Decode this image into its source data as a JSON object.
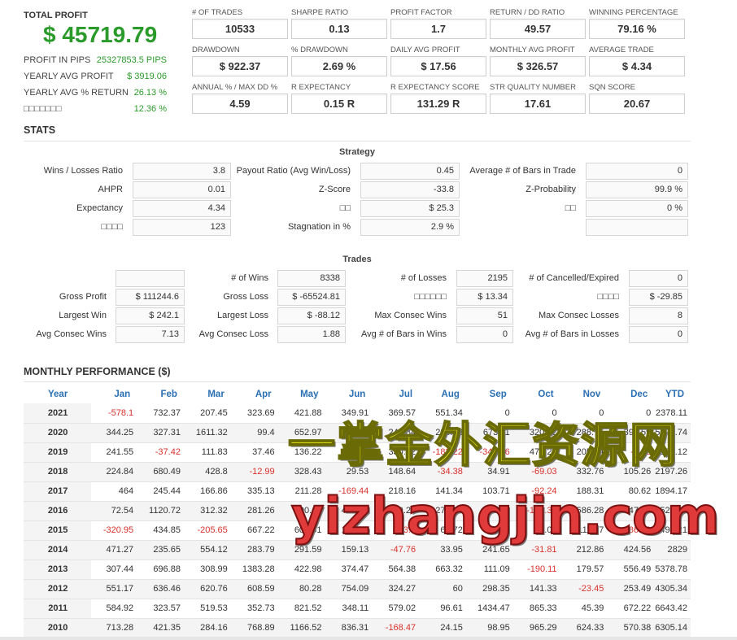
{
  "summary": {
    "total_profit_label": "TOTAL PROFIT",
    "total_profit_value": "$ 45719.79",
    "rows": [
      {
        "label": "PROFIT IN PIPS",
        "value": "25327853.5 PIPS"
      },
      {
        "label": "YEARLY AVG PROFIT",
        "value": "$ 3919.06"
      },
      {
        "label": "YEARLY AVG % RETURN",
        "value": "26.13 %"
      },
      {
        "label": "□□□□□□□",
        "value": "12.36 %"
      }
    ]
  },
  "metrics": [
    {
      "label": "# OF TRADES",
      "value": "10533"
    },
    {
      "label": "SHARPE RATIO",
      "value": "0.13"
    },
    {
      "label": "PROFIT FACTOR",
      "value": "1.7"
    },
    {
      "label": "RETURN / DD RATIO",
      "value": "49.57"
    },
    {
      "label": "WINNING PERCENTAGE",
      "value": "79.16 %"
    },
    {
      "label": "DRAWDOWN",
      "value": "$ 922.37"
    },
    {
      "label": "% DRAWDOWN",
      "value": "2.69 %"
    },
    {
      "label": "DAILY AVG PROFIT",
      "value": "$ 17.56"
    },
    {
      "label": "MONTHLY AVG PROFIT",
      "value": "$ 326.57"
    },
    {
      "label": "AVERAGE TRADE",
      "value": "$ 4.34"
    },
    {
      "label": "ANNUAL % / MAX DD %",
      "value": "4.59"
    },
    {
      "label": "R EXPECTANCY",
      "value": "0.15 R"
    },
    {
      "label": "R EXPECTANCY SCORE",
      "value": "131.29 R"
    },
    {
      "label": "STR QUALITY NUMBER",
      "value": "17.61"
    },
    {
      "label": "SQN SCORE",
      "value": "20.67"
    }
  ],
  "stats_title": "STATS",
  "strategy": {
    "title": "Strategy",
    "rows": [
      [
        {
          "label": "Wins / Losses Ratio",
          "value": "3.8"
        },
        {
          "label": "Payout Ratio (Avg Win/Loss)",
          "value": "0.45"
        },
        {
          "label": "Average # of Bars in Trade",
          "value": "0"
        }
      ],
      [
        {
          "label": "AHPR",
          "value": "0.01"
        },
        {
          "label": "Z-Score",
          "value": "-33.8"
        },
        {
          "label": "Z-Probability",
          "value": "99.9 %"
        }
      ],
      [
        {
          "label": "Expectancy",
          "value": "4.34"
        },
        {
          "label": "□□",
          "value": "$ 25.3"
        },
        {
          "label": "□□",
          "value": "0 %"
        }
      ],
      [
        {
          "label": "□□□□",
          "value": "123"
        },
        {
          "label": "Stagnation in %",
          "value": "2.9 %"
        },
        {
          "label": "",
          "value": ""
        }
      ]
    ]
  },
  "trades": {
    "title": "Trades",
    "rows": [
      [
        {
          "label": "",
          "value": ""
        },
        {
          "label": "# of Wins",
          "value": "8338"
        },
        {
          "label": "# of Losses",
          "value": "2195"
        },
        {
          "label": "# of Cancelled/Expired",
          "value": "0"
        }
      ],
      [
        {
          "label": "Gross Profit",
          "value": "$ 111244.6"
        },
        {
          "label": "Gross Loss",
          "value": "$ -65524.81"
        },
        {
          "label": "□□□□□□",
          "value": "$ 13.34"
        },
        {
          "label": "□□□□",
          "value": "$ -29.85"
        }
      ],
      [
        {
          "label": "Largest Win",
          "value": "$ 242.1"
        },
        {
          "label": "Largest Loss",
          "value": "$ -88.12"
        },
        {
          "label": "Max Consec Wins",
          "value": "51"
        },
        {
          "label": "Max Consec Losses",
          "value": "8"
        }
      ],
      [
        {
          "label": "Avg Consec Wins",
          "value": "7.13"
        },
        {
          "label": "Avg Consec Loss",
          "value": "1.88"
        },
        {
          "label": "Avg # of Bars in Wins",
          "value": "0"
        },
        {
          "label": "Avg # of Bars in Losses",
          "value": "0"
        }
      ]
    ]
  },
  "monthly": {
    "title": "MONTHLY PERFORMANCE ($)",
    "headers": [
      "Year",
      "Jan",
      "Feb",
      "Mar",
      "Apr",
      "May",
      "Jun",
      "Jul",
      "Aug",
      "Sep",
      "Oct",
      "Nov",
      "Dec",
      "YTD"
    ],
    "rows": [
      [
        "2021",
        "-578.1",
        "732.37",
        "207.45",
        "323.69",
        "421.88",
        "349.91",
        "369.57",
        "551.34",
        "0",
        "0",
        "0",
        "0",
        "2378.11"
      ],
      [
        "2020",
        "344.25",
        "327.31",
        "1611.32",
        "99.4",
        "652.97",
        "935.58",
        "244.84",
        "285.76",
        "673.11",
        "320.92",
        "288.75",
        "395.59",
        "5878.74"
      ],
      [
        "2019",
        "241.55",
        "-37.42",
        "111.83",
        "37.46",
        "136.22",
        "-4.85",
        "330.52",
        "-182.22",
        "-347.36",
        "478.27",
        "205.44",
        "-2.02",
        "1127.12"
      ],
      [
        "2018",
        "224.84",
        "680.49",
        "428.8",
        "-12.99",
        "328.43",
        "29.53",
        "148.64",
        "-34.38",
        "34.91",
        "-69.03",
        "332.76",
        "105.26",
        "2197.26"
      ],
      [
        "2017",
        "464",
        "245.44",
        "166.86",
        "335.13",
        "211.28",
        "-169.44",
        "218.16",
        "141.34",
        "103.71",
        "-92.24",
        "188.31",
        "80.62",
        "1894.17"
      ],
      [
        "2016",
        "72.54",
        "1120.72",
        "312.32",
        "281.26",
        "400.68",
        "482.78",
        "879.28",
        "270.98",
        "484.45",
        "-152.37",
        "586.28",
        "547.59",
        "5286.5"
      ],
      [
        "2015",
        "-320.95",
        "434.85",
        "-205.65",
        "667.22",
        "602.61",
        "176.78",
        "-93.9",
        "68.72",
        "156",
        "90.05",
        "111.97",
        "-186.49",
        "1495.21"
      ],
      [
        "2014",
        "471.27",
        "235.65",
        "554.12",
        "283.79",
        "291.59",
        "159.13",
        "-47.76",
        "33.95",
        "241.65",
        "-31.81",
        "212.86",
        "424.56",
        "2829"
      ],
      [
        "2013",
        "307.44",
        "696.88",
        "308.99",
        "1383.28",
        "422.98",
        "374.47",
        "564.38",
        "663.32",
        "111.09",
        "-190.11",
        "179.57",
        "556.49",
        "5378.78"
      ],
      [
        "2012",
        "551.17",
        "636.46",
        "620.76",
        "608.59",
        "80.28",
        "754.09",
        "324.27",
        "60",
        "298.35",
        "141.33",
        "-23.45",
        "253.49",
        "4305.34"
      ],
      [
        "2011",
        "584.92",
        "323.57",
        "519.53",
        "352.73",
        "821.52",
        "348.11",
        "579.02",
        "96.61",
        "1434.47",
        "865.33",
        "45.39",
        "672.22",
        "6643.42"
      ],
      [
        "2010",
        "713.28",
        "421.35",
        "284.16",
        "768.89",
        "1166.52",
        "836.31",
        "-168.47",
        "24.15",
        "98.95",
        "965.29",
        "624.33",
        "570.38",
        "6305.14"
      ]
    ]
  },
  "watermark": {
    "line1": "一掌金外汇资源网",
    "line2": "yizhangjin.com"
  },
  "colors": {
    "positive": "#2a9a2a",
    "negative": "#d9312c",
    "header_blue": "#2a6fb3"
  }
}
